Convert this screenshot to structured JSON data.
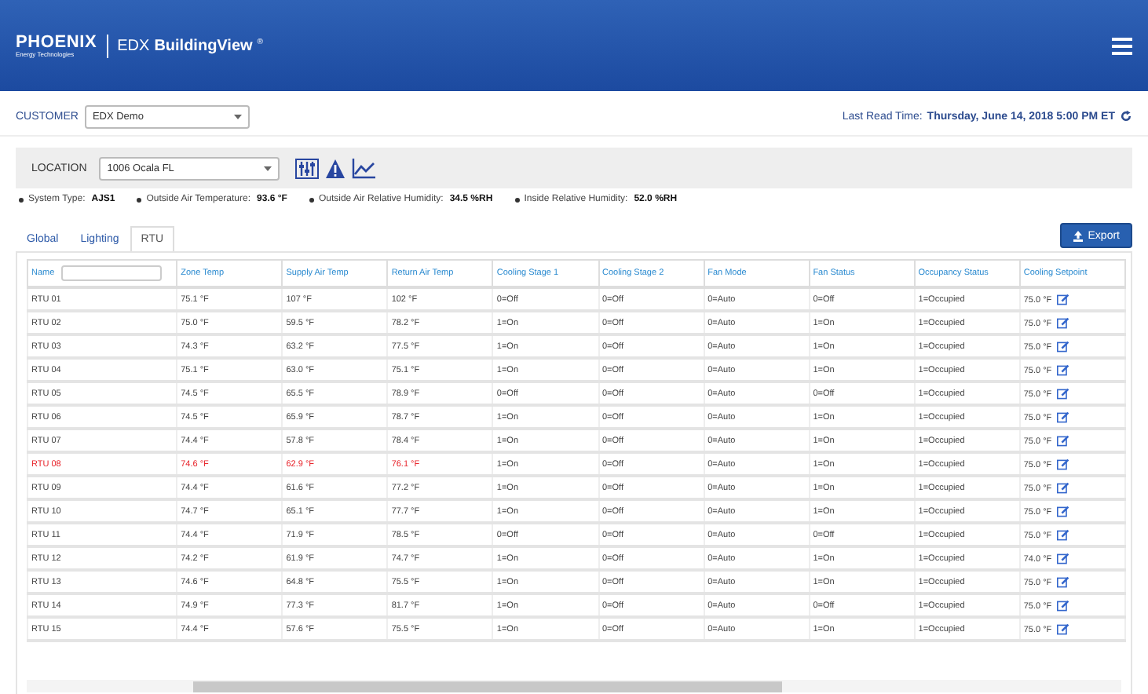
{
  "header": {
    "brand": "PHOENIX",
    "brand_sub": "Energy Technologies",
    "product_prefix": "EDX",
    "product": "BuildingView",
    "product_mark": "®"
  },
  "customer": {
    "label": "CUSTOMER",
    "value": "EDX Demo"
  },
  "last_read": {
    "label": "Last Read Time:",
    "value": "Thursday, June 14, 2018 5:00 PM ET"
  },
  "location": {
    "label": "LOCATION",
    "value": "1006 Ocala FL"
  },
  "info": [
    {
      "label": "System Type:",
      "value": "AJS1"
    },
    {
      "label": "Outside Air Temperature:",
      "value": "93.6 °F"
    },
    {
      "label": "Outside Air Relative Humidity:",
      "value": "34.5 %RH"
    },
    {
      "label": "Inside Relative Humidity:",
      "value": "52.0 %RH"
    }
  ],
  "tabs": [
    {
      "label": "Global",
      "selected": false
    },
    {
      "label": "Lighting",
      "selected": false
    },
    {
      "label": "RTU",
      "selected": true
    }
  ],
  "export_button": "Export",
  "table": {
    "columns": [
      "Name",
      "Zone Temp",
      "Supply Air Temp",
      "Return Air Temp",
      "Cooling Stage 1",
      "Cooling Stage 2",
      "Fan Mode",
      "Fan Status",
      "Occupancy Status",
      "Cooling Setpoint"
    ],
    "rows": [
      {
        "alarm": false,
        "cells": [
          "RTU 01",
          "75.1 °F",
          "107 °F",
          "102 °F",
          "0=Off",
          "0=Off",
          "0=Auto",
          "0=Off",
          "1=Occupied",
          "75.0 °F"
        ]
      },
      {
        "alarm": false,
        "cells": [
          "RTU 02",
          "75.0 °F",
          "59.5 °F",
          "78.2 °F",
          "1=On",
          "0=Off",
          "0=Auto",
          "1=On",
          "1=Occupied",
          "75.0 °F"
        ]
      },
      {
        "alarm": false,
        "cells": [
          "RTU 03",
          "74.3 °F",
          "63.2 °F",
          "77.5 °F",
          "1=On",
          "0=Off",
          "0=Auto",
          "1=On",
          "1=Occupied",
          "75.0 °F"
        ]
      },
      {
        "alarm": false,
        "cells": [
          "RTU 04",
          "75.1 °F",
          "63.0 °F",
          "75.1 °F",
          "1=On",
          "0=Off",
          "0=Auto",
          "1=On",
          "1=Occupied",
          "75.0 °F"
        ]
      },
      {
        "alarm": false,
        "cells": [
          "RTU 05",
          "74.5 °F",
          "65.5 °F",
          "78.9 °F",
          "0=Off",
          "0=Off",
          "0=Auto",
          "0=Off",
          "1=Occupied",
          "75.0 °F"
        ]
      },
      {
        "alarm": false,
        "cells": [
          "RTU 06",
          "74.5 °F",
          "65.9 °F",
          "78.7 °F",
          "1=On",
          "0=Off",
          "0=Auto",
          "1=On",
          "1=Occupied",
          "75.0 °F"
        ]
      },
      {
        "alarm": false,
        "cells": [
          "RTU 07",
          "74.4 °F",
          "57.8 °F",
          "78.4 °F",
          "1=On",
          "0=Off",
          "0=Auto",
          "1=On",
          "1=Occupied",
          "75.0 °F"
        ]
      },
      {
        "alarm": true,
        "cells": [
          "RTU 08",
          "74.6 °F",
          "62.9 °F",
          "76.1 °F",
          "1=On",
          "0=Off",
          "0=Auto",
          "1=On",
          "1=Occupied",
          "75.0 °F"
        ]
      },
      {
        "alarm": false,
        "cells": [
          "RTU 09",
          "74.4 °F",
          "61.6 °F",
          "77.2 °F",
          "1=On",
          "0=Off",
          "0=Auto",
          "1=On",
          "1=Occupied",
          "75.0 °F"
        ]
      },
      {
        "alarm": false,
        "cells": [
          "RTU 10",
          "74.7 °F",
          "65.1 °F",
          "77.7 °F",
          "1=On",
          "0=Off",
          "0=Auto",
          "1=On",
          "1=Occupied",
          "75.0 °F"
        ]
      },
      {
        "alarm": false,
        "cells": [
          "RTU 11",
          "74.4 °F",
          "71.9 °F",
          "78.5 °F",
          "0=Off",
          "0=Off",
          "0=Auto",
          "0=Off",
          "1=Occupied",
          "75.0 °F"
        ]
      },
      {
        "alarm": false,
        "cells": [
          "RTU 12",
          "74.2 °F",
          "61.9 °F",
          "74.7 °F",
          "1=On",
          "0=Off",
          "0=Auto",
          "1=On",
          "1=Occupied",
          "74.0 °F"
        ]
      },
      {
        "alarm": false,
        "cells": [
          "RTU 13",
          "74.6 °F",
          "64.8 °F",
          "75.5 °F",
          "1=On",
          "0=Off",
          "0=Auto",
          "1=On",
          "1=Occupied",
          "75.0 °F"
        ]
      },
      {
        "alarm": false,
        "cells": [
          "RTU 14",
          "74.9 °F",
          "77.3 °F",
          "81.7 °F",
          "1=On",
          "0=Off",
          "0=Auto",
          "0=Off",
          "1=Occupied",
          "75.0 °F"
        ]
      },
      {
        "alarm": false,
        "cells": [
          "RTU 15",
          "74.4 °F",
          "57.6 °F",
          "75.5 °F",
          "1=On",
          "0=Off",
          "0=Auto",
          "1=On",
          "1=Occupied",
          "75.0 °F"
        ]
      }
    ]
  }
}
